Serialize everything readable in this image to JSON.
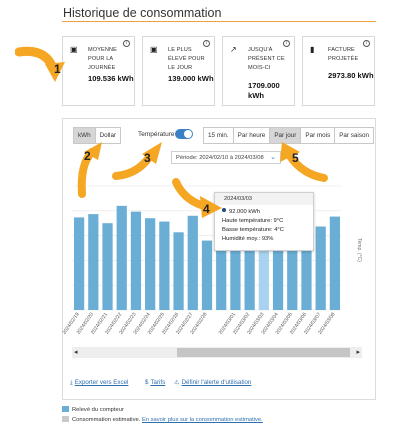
{
  "page": {
    "title": "Historique de consommation"
  },
  "cards": [
    {
      "icon": "calendar-icon",
      "label": "Moyenne pour la journée",
      "value": "109.536 kWh"
    },
    {
      "icon": "calendar-icon",
      "label": "Le plus élevé pour le jour",
      "value": "139.000 kWh"
    },
    {
      "icon": "trend-up-icon",
      "label": "Jusqu'à présent ce mois-ci",
      "value": "1709.000 kWh"
    },
    {
      "icon": "bar-chart-icon",
      "label": "Facture projetée",
      "value": "2973.80 kWh"
    }
  ],
  "card_info": "i",
  "unit_toggle": {
    "kwh": "kWh",
    "dollar": "Dollar",
    "selected": "kWh"
  },
  "temperature": {
    "label": "Température",
    "on": true
  },
  "intervals": {
    "items": [
      "15 min.",
      "Par heure",
      "Par jour",
      "Par mois",
      "Par saison"
    ],
    "selected": "Par jour"
  },
  "period": {
    "text": "Période: 2024/02/10 à 2024/03/08"
  },
  "chart_data": {
    "type": "bar",
    "categories": [
      "2024/02/19",
      "2024/02/20",
      "2024/02/21",
      "2024/02/22",
      "2024/02/23",
      "2024/02/24",
      "2024/02/25",
      "2024/02/26",
      "2024/02/27",
      "2024/02/28",
      "2024/02/29",
      "2024/03/01",
      "2024/03/02",
      "2024/03/03",
      "2024/03/04",
      "2024/03/05",
      "2024/03/06",
      "2024/03/07",
      "2024/03/08"
    ],
    "visible_tick_labels": [
      "2024/02/19",
      "2024/02/20",
      "2024/02/21",
      "2024/02/22",
      "2024/02/23",
      "2024/02/24",
      "2024/02/25",
      "2024/02/26",
      "2024/02/27",
      "2024/02/28",
      "2024/03/01",
      "2024/03/02",
      "2024/03/03",
      "2024/03/04",
      "2024/03/05",
      "2024/03/06",
      "2024/03/07",
      "2024/03/08"
    ],
    "values": [
      112,
      116,
      105,
      126,
      119,
      111,
      107,
      94,
      114,
      84,
      94,
      104,
      92,
      92,
      87,
      94,
      96,
      101,
      113
    ],
    "highlighted": "2024/03/03",
    "ylim": [
      0,
      150
    ],
    "grid": true,
    "right_axis_label": "Temp. (°C)",
    "right_axis_ticks": [
      "",
      "",
      "",
      "",
      "",
      ""
    ],
    "bar_color": "#6aaed6",
    "highlight_color": "#a8d2ef"
  },
  "tooltip": {
    "date": "2024/03/03",
    "value": "92.000 kWh",
    "high": "Haute température: 9°C",
    "low": "Basse température: 4°C",
    "humidity": "Humidité moy.: 93%"
  },
  "scrollbar": {
    "left": "◂",
    "right": "▸"
  },
  "links": {
    "excel": "Exporter vers Excel",
    "tarifs": "Tarifs",
    "alert": "Définir l'alerte d'utilisation"
  },
  "legend": {
    "meter": "Relevé du compteur",
    "estimate_prefix": "Consommation estimative.",
    "estimate_link": "En savoir plus sur la consommation estimative.",
    "meter_color": "#6aaed6",
    "estimate_color": "#c9c9c9"
  },
  "callouts": [
    "1",
    "2",
    "3",
    "4",
    "5"
  ],
  "accent": "#f5a623"
}
